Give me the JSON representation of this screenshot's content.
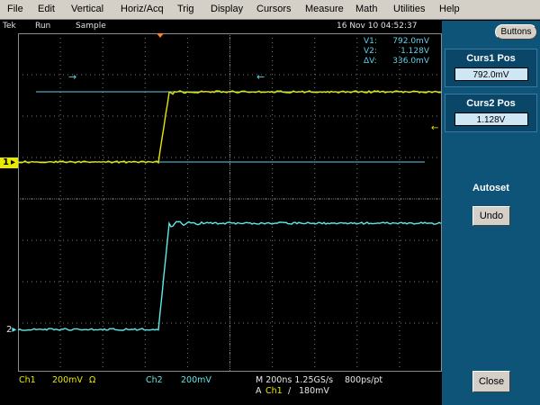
{
  "menu": [
    "File",
    "Edit",
    "Vertical",
    "Horiz/Acq",
    "Trig",
    "Display",
    "Cursors",
    "Measure",
    "Math",
    "Utilities",
    "Help"
  ],
  "status": {
    "brand": "Tek",
    "run_state": "Run",
    "mode": "Sample",
    "datetime": "16 Nov 10 04:52:37"
  },
  "cursor_readout": {
    "v1_label": "V1:",
    "v1_value": "792.0mV",
    "v2_label": "V2:",
    "v2_value": "1.128V",
    "dv_label": "ΔV:",
    "dv_value": "336.0mV"
  },
  "channels": {
    "ch1_marker": "1",
    "ch2_marker": "2"
  },
  "readout": {
    "ch1_label": "Ch1",
    "ch1_scale": "200mV",
    "ch1_coupling": "Ω",
    "ch2_label": "Ch2",
    "ch2_scale": "200mV",
    "timebase": "M 200ns 1.25GS/s",
    "resolution": "800ps/pt",
    "trigger_prefix": "A",
    "trigger_source": "Ch1",
    "trigger_slope": "/",
    "trigger_level": "180mV"
  },
  "panel": {
    "buttons_label": "Buttons",
    "curs1_title": "Curs1 Pos",
    "curs1_value": "792.0mV",
    "curs2_title": "Curs2 Pos",
    "curs2_value": "1.128V",
    "autoset_label": "Autoset",
    "undo_label": "Undo",
    "close_label": "Close"
  },
  "colors": {
    "ch1": "#e8e800",
    "ch2": "#5fe8e8",
    "cursor": "#5fd0e8",
    "trigger_marker": "#ff8030",
    "panel_bg": "#0e5378"
  }
}
